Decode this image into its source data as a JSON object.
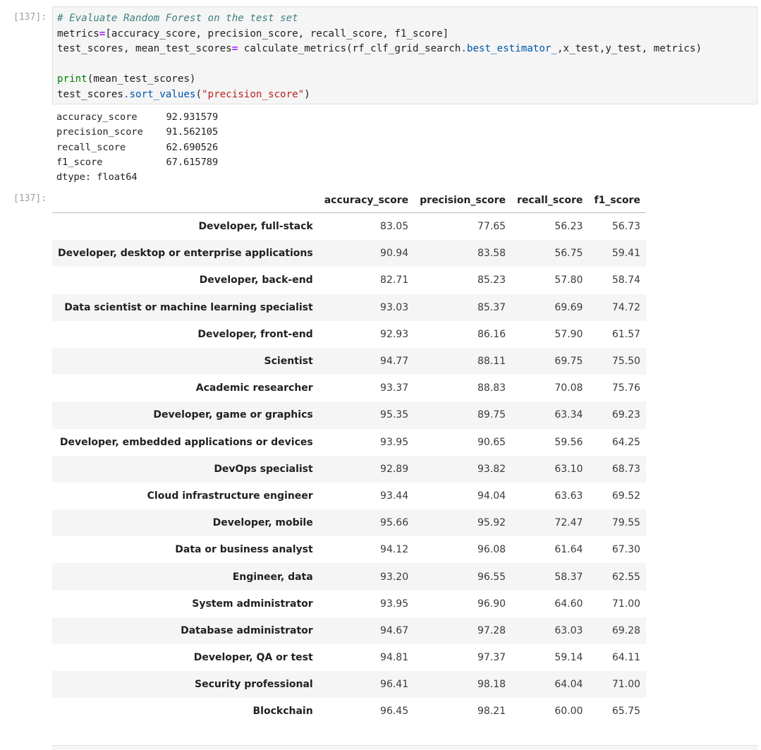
{
  "cell": {
    "in_prompt": "[137]:",
    "out_prompt": "[137]:",
    "code": {
      "comment": "# Evaluate Random Forest on the test set",
      "l2_a": "metrics",
      "l2_eq": "=",
      "l2_b": "[accuracy_score, precision_score, recall_score, f1_score]",
      "l3_a": "test_scores, mean_test_scores",
      "l3_eq": "=",
      "l3_b": " calculate_metrics(rf_clf_grid_search",
      "l3_attr": ".best_estimator_",
      "l3_c": ",x_test,y_test, metrics)",
      "l5_fn": "print",
      "l5_b": "(mean_test_scores)",
      "l6_a": "test_scores",
      "l6_attr": ".sort_values",
      "l6_b": "(",
      "l6_str": "\"precision_score\"",
      "l6_c": ")"
    },
    "stdout": "accuracy_score     92.931579\nprecision_score    91.562105\nrecall_score       62.690526\nf1_score           67.615789\ndtype: float64"
  },
  "table": {
    "columns": [
      "",
      "accuracy_score",
      "precision_score",
      "recall_score",
      "f1_score"
    ],
    "rows": [
      {
        "label": "Developer, full-stack",
        "values": [
          "83.05",
          "77.65",
          "56.23",
          "56.73"
        ]
      },
      {
        "label": "Developer, desktop or enterprise applications",
        "values": [
          "90.94",
          "83.58",
          "56.75",
          "59.41"
        ]
      },
      {
        "label": "Developer, back-end",
        "values": [
          "82.71",
          "85.23",
          "57.80",
          "58.74"
        ]
      },
      {
        "label": "Data scientist or machine learning specialist",
        "values": [
          "93.03",
          "85.37",
          "69.69",
          "74.72"
        ]
      },
      {
        "label": "Developer, front-end",
        "values": [
          "92.93",
          "86.16",
          "57.90",
          "61.57"
        ]
      },
      {
        "label": "Scientist",
        "values": [
          "94.77",
          "88.11",
          "69.75",
          "75.50"
        ]
      },
      {
        "label": "Academic researcher",
        "values": [
          "93.37",
          "88.83",
          "70.08",
          "75.76"
        ]
      },
      {
        "label": "Developer, game or graphics",
        "values": [
          "95.35",
          "89.75",
          "63.34",
          "69.23"
        ]
      },
      {
        "label": "Developer, embedded applications or devices",
        "values": [
          "93.95",
          "90.65",
          "59.56",
          "64.25"
        ]
      },
      {
        "label": "DevOps specialist",
        "values": [
          "92.89",
          "93.82",
          "63.10",
          "68.73"
        ]
      },
      {
        "label": "Cloud infrastructure engineer",
        "values": [
          "93.44",
          "94.04",
          "63.63",
          "69.52"
        ]
      },
      {
        "label": "Developer, mobile",
        "values": [
          "95.66",
          "95.92",
          "72.47",
          "79.55"
        ]
      },
      {
        "label": "Data or business analyst",
        "values": [
          "94.12",
          "96.08",
          "61.64",
          "67.30"
        ]
      },
      {
        "label": "Engineer, data",
        "values": [
          "93.20",
          "96.55",
          "58.37",
          "62.55"
        ]
      },
      {
        "label": "System administrator",
        "values": [
          "93.95",
          "96.90",
          "64.60",
          "71.00"
        ]
      },
      {
        "label": "Database administrator",
        "values": [
          "94.67",
          "97.28",
          "63.03",
          "69.28"
        ]
      },
      {
        "label": "Developer, QA or test",
        "values": [
          "94.81",
          "97.37",
          "59.14",
          "64.11"
        ]
      },
      {
        "label": "Security professional",
        "values": [
          "96.41",
          "98.18",
          "64.04",
          "71.00"
        ]
      },
      {
        "label": "Blockchain",
        "values": [
          "96.45",
          "98.21",
          "60.00",
          "65.75"
        ]
      }
    ]
  }
}
